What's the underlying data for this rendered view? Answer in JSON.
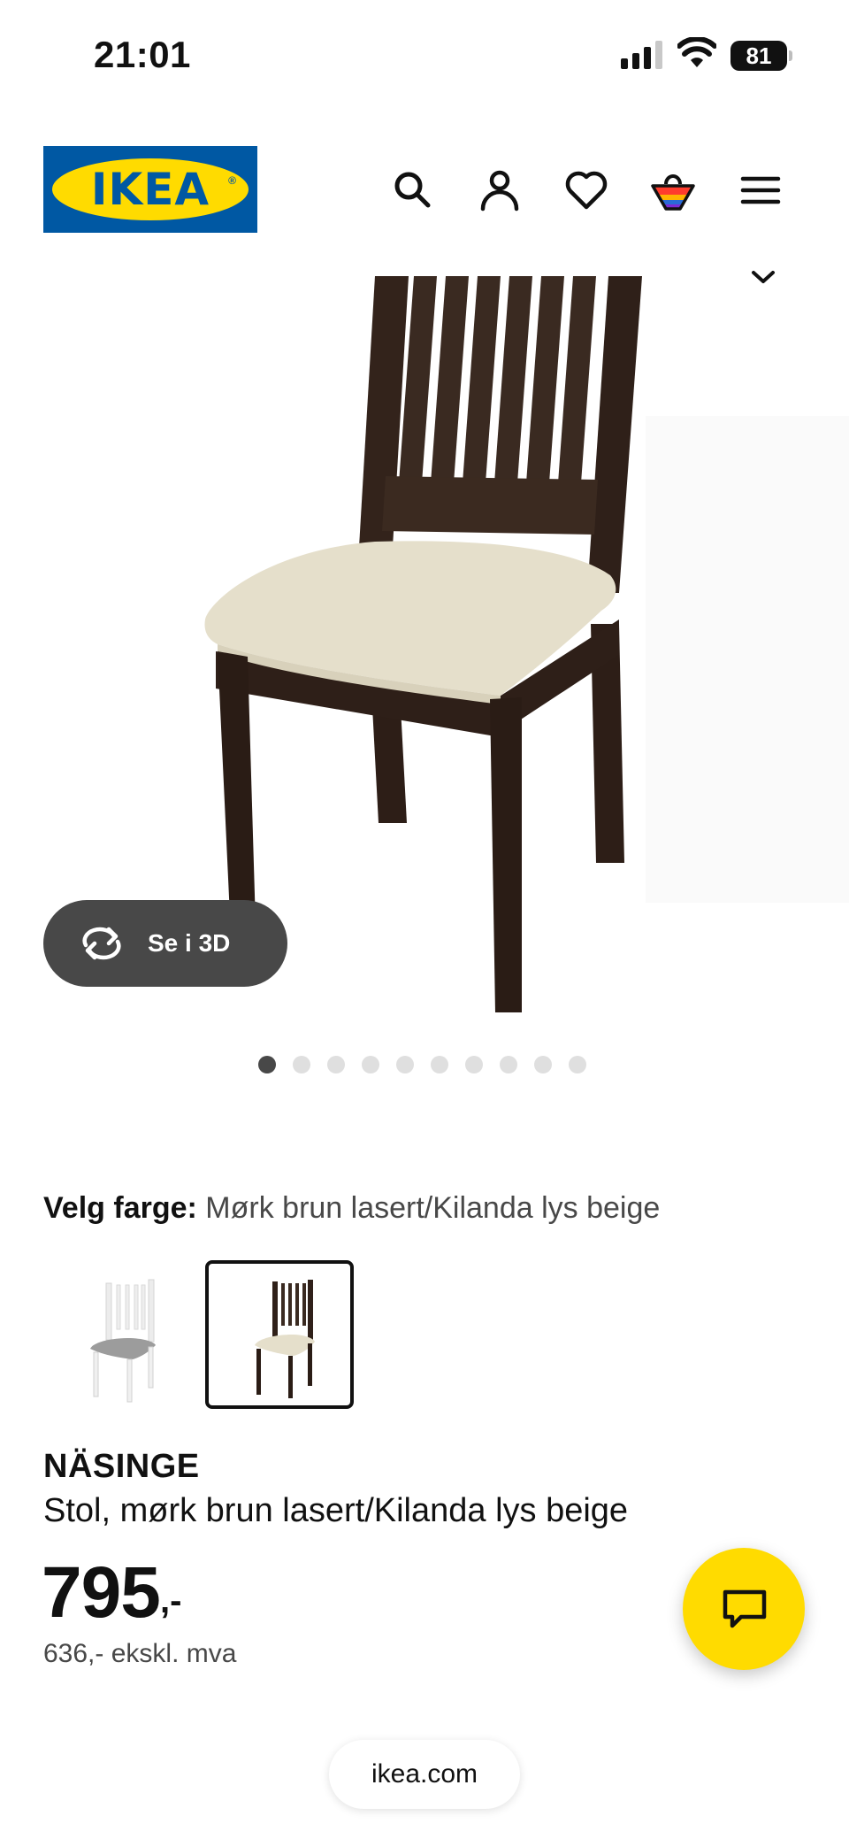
{
  "status_bar": {
    "time": "21:01",
    "battery": "81"
  },
  "header": {
    "logo_text": "IKEA",
    "icons": [
      "search-icon",
      "account-icon",
      "heart-icon",
      "cart-icon",
      "menu-icon"
    ]
  },
  "gallery": {
    "view_3d_label": "Se i 3D",
    "slide_count": 10,
    "active_slide": 1
  },
  "color_select": {
    "label": "Velg farge:",
    "value": "Mørk brun lasert/Kilanda lys beige",
    "swatches": [
      "Hvit/Orrsta lys grå",
      "Mørk brun lasert/Kilanda lys beige"
    ],
    "selected_swatch": 2
  },
  "product": {
    "name": "NÄSINGE",
    "description": "Stol, mørk brun lasert/Kilanda lys beige",
    "price": "795",
    "price_suffix": ",-",
    "price_ex_vat": "636,- ekskl. mva"
  },
  "browser": {
    "url": "ikea.com"
  },
  "colors": {
    "ikea_blue": "#0058a3",
    "ikea_yellow": "#ffdb00",
    "dark_button": "#484848"
  }
}
